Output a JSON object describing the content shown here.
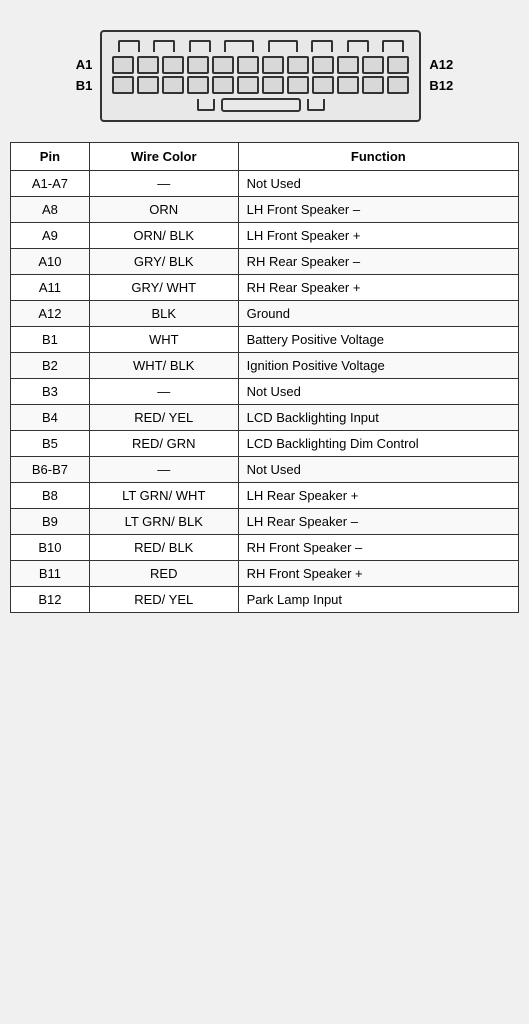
{
  "diagram": {
    "labels_left": [
      "A1",
      "B1"
    ],
    "labels_right": [
      "A12",
      "B12"
    ]
  },
  "table": {
    "headers": [
      "Pin",
      "Wire Color",
      "Function"
    ],
    "rows": [
      {
        "pin": "A1-A7",
        "color": "—",
        "function": "Not Used"
      },
      {
        "pin": "A8",
        "color": "ORN",
        "function": "LH Front Speaker –"
      },
      {
        "pin": "A9",
        "color": "ORN/ BLK",
        "function": "LH Front Speaker +"
      },
      {
        "pin": "A10",
        "color": "GRY/ BLK",
        "function": "RH Rear Speaker –"
      },
      {
        "pin": "A11",
        "color": "GRY/ WHT",
        "function": "RH Rear Speaker +"
      },
      {
        "pin": "A12",
        "color": "BLK",
        "function": "Ground"
      },
      {
        "pin": "B1",
        "color": "WHT",
        "function": "Battery Positive Voltage"
      },
      {
        "pin": "B2",
        "color": "WHT/ BLK",
        "function": "Ignition Positive Voltage"
      },
      {
        "pin": "B3",
        "color": "—",
        "function": "Not Used"
      },
      {
        "pin": "B4",
        "color": "RED/ YEL",
        "function": "LCD Backlighting Input"
      },
      {
        "pin": "B5",
        "color": "RED/ GRN",
        "function": "LCD Backlighting Dim Control"
      },
      {
        "pin": "B6-B7",
        "color": "—",
        "function": "Not Used"
      },
      {
        "pin": "B8",
        "color": "LT GRN/ WHT",
        "function": "LH Rear Speaker +"
      },
      {
        "pin": "B9",
        "color": "LT GRN/ BLK",
        "function": "LH Rear Speaker –"
      },
      {
        "pin": "B10",
        "color": "RED/ BLK",
        "function": "RH Front Speaker –"
      },
      {
        "pin": "B11",
        "color": "RED",
        "function": "RH Front Speaker +"
      },
      {
        "pin": "B12",
        "color": "RED/ YEL",
        "function": "Park Lamp Input"
      }
    ]
  }
}
